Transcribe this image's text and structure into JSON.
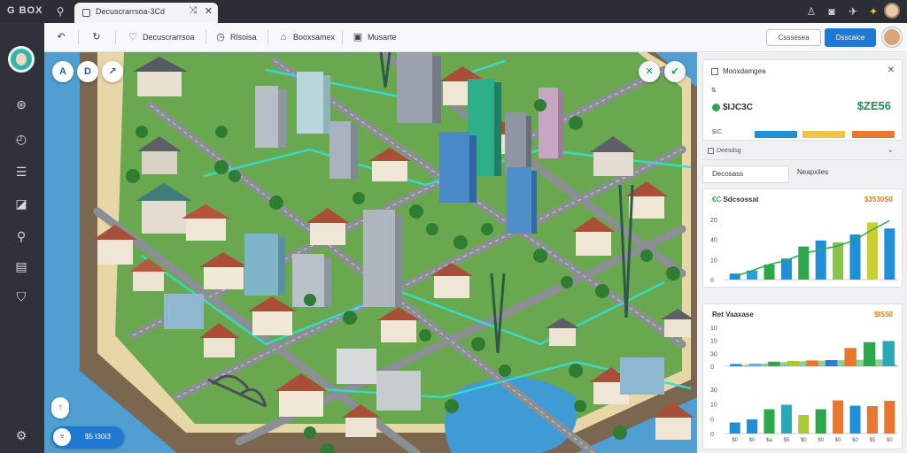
{
  "titlebar": {
    "brand": "G BOX",
    "tab_label": "Decuscrarrsoa-3Cd",
    "icons": [
      "alien-icon",
      "swap-icon"
    ]
  },
  "toolbar": {
    "items": [
      {
        "icon": "back-icon",
        "label": ""
      },
      {
        "icon": "refresh-icon",
        "label": ""
      },
      {
        "icon": "tag-icon",
        "label": "Decuscrarrsoa"
      },
      {
        "icon": "clock-icon",
        "label": "Rlsoisa"
      },
      {
        "icon": "chat-icon",
        "label": "Booxsamex"
      },
      {
        "icon": "doc-icon",
        "label": "Musarte"
      }
    ],
    "outline_button": "Csssesea",
    "primary_button": "Dsscaice"
  },
  "sidebar": {
    "items": [
      "compass-icon",
      "clock-icon",
      "list-icon",
      "image-icon",
      "search-icon",
      "file-icon",
      "shield-icon",
      "settings-icon"
    ]
  },
  "map": {
    "top_left_buttons": [
      "A",
      "D",
      "↗"
    ],
    "top_right_buttons": [
      "✕",
      "↙"
    ],
    "mini_button": "↑",
    "pill_label": "$5 I30I3"
  },
  "panel": {
    "summary": {
      "title": "Mooxdamgea",
      "stat_label": "$IJC3C",
      "stat_value": "$ZE56",
      "small_label": "$IC",
      "bar_colors": [
        "#1f8fd8",
        "#f1b63a",
        "#e8762c"
      ]
    },
    "dropdown_label": "Deesdsg",
    "tabs": [
      "Decosass",
      "Neapxiles"
    ],
    "chart1": {
      "title": "Sdcsossat",
      "value": "$3530S0",
      "icon_value": "€C"
    },
    "chart2": {
      "title": "Ret Vaaxase",
      "value": "$IS50"
    }
  },
  "chart_data": [
    {
      "type": "bar",
      "title": "Sdcsossat",
      "yticks": [
        "20",
        "40",
        "10",
        "0"
      ],
      "values": [
        1,
        1.5,
        2.5,
        3.5,
        5.5,
        6.5,
        6.2,
        7.5,
        9.5,
        8.5
      ],
      "colors": [
        "#1f8fd8",
        "#2b9fd9",
        "#2ca84a",
        "#1f8fd8",
        "#2ca84a",
        "#1f8fd8",
        "#8bc34a",
        "#1f8fd8",
        "#c9cf2c",
        "#1f8fd8"
      ],
      "trend": [
        0.5,
        1.5,
        2.5,
        3.2,
        4.3,
        5.0,
        5.6,
        6.6,
        8.3,
        9.8
      ],
      "ylim": [
        0,
        10
      ]
    },
    {
      "type": "bar",
      "title": "Ret Vaaxase",
      "yticks": [
        "10",
        "10",
        "30",
        "0"
      ],
      "values": [
        0.6,
        0.7,
        1.2,
        1.4,
        1.5,
        1.6,
        4.7,
        6.2,
        6.5
      ],
      "colors": [
        "#1f8fd8",
        "#4fb3ff",
        "#2ca84a",
        "#a8c83a",
        "#e8762c",
        "#2c7bd8",
        "#e8762c",
        "#2ca84a",
        "#27a9b8"
      ],
      "area": [
        0.2,
        0.5,
        0.9,
        1.2,
        1.4,
        1.5,
        1.6,
        1.7,
        1.8
      ],
      "ylim": [
        0,
        10
      ]
    },
    {
      "type": "bar",
      "title": "",
      "yticks": [
        "30",
        "10",
        "0",
        "0"
      ],
      "xticks": [
        "$0",
        "$0",
        "$a",
        "$5",
        "$0",
        "$0",
        "$0",
        "$0",
        "$5",
        "$0"
      ],
      "values": [
        2.5,
        3.2,
        5.5,
        6.5,
        4.2,
        5.5,
        7.5,
        6.3,
        6.2,
        7.4
      ],
      "colors": [
        "#1f8fd8",
        "#1f8fd8",
        "#2ca84a",
        "#27a9b8",
        "#a8c83a",
        "#2ca84a",
        "#e8762c",
        "#1f8fd8",
        "#e8762c",
        "#e8762c"
      ],
      "ylim": [
        0,
        10
      ]
    }
  ]
}
